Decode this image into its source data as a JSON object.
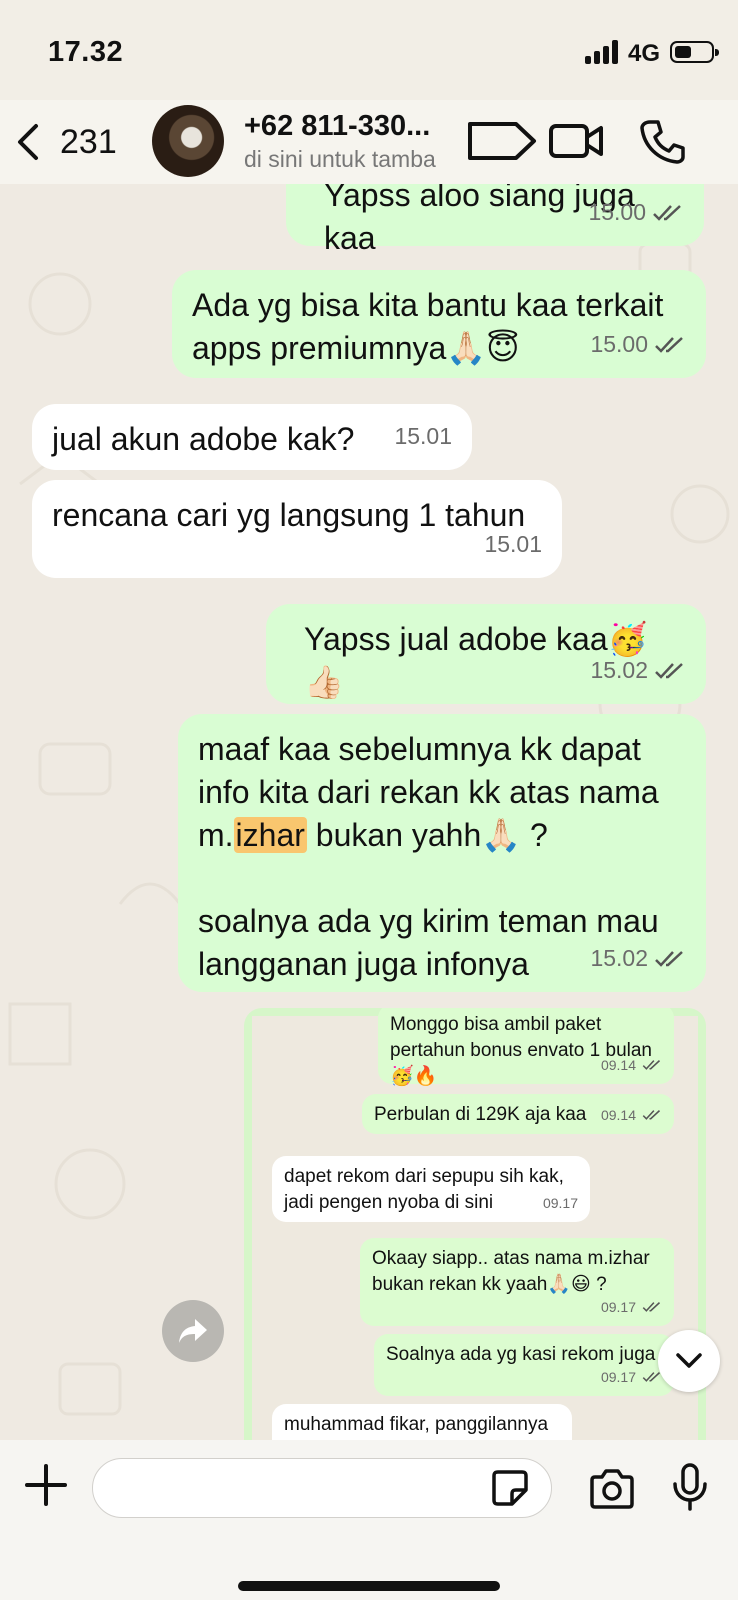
{
  "status": {
    "time": "17.32",
    "network": "4G",
    "battery_level": 0.35
  },
  "header": {
    "back_count": "231",
    "contact_name": "+62 811-330...",
    "contact_sub": "di sini untuk tamba"
  },
  "messages": [
    {
      "text": "Yapss aloo siang juga kaa",
      "time": "15.00"
    },
    {
      "text": "Ada yg bisa kita bantu kaa terkait apps premiumnya🙏🏻😇",
      "time": "15.00"
    },
    {
      "text": "jual akun adobe kak?",
      "time": "15.01"
    },
    {
      "text": "rencana cari yg langsung 1 tahun",
      "time": "15.01"
    },
    {
      "text": "Yapss jual adobe kaa🥳👍🏻",
      "time": "15.02"
    },
    {
      "line1": "maaf kaa sebelumnya kk dapat",
      "line2": "info kita dari rekan kk atas nama",
      "line3_pre": "m.",
      "line3_hl": "izhar",
      "line3_post": " bukan yahh🙏🏻 ?",
      "line4": "soalnya ada yg kirim teman mau",
      "line5": "langganan juga infonya",
      "time": "15.02"
    }
  ],
  "forwarded": [
    {
      "text": "Monggo bisa ambil paket pertahun bonus envato 1 bulan 🥳🔥",
      "time": "09.14"
    },
    {
      "text": "Perbulan di 129K aja kaa",
      "time": "09.14"
    },
    {
      "text": "dapet rekom dari sepupu sih kak, jadi pengen nyoba di sini",
      "time": "09.17"
    },
    {
      "text": "Okaay siapp.. atas nama m.izhar bukan rekan kk yaah🙏🏻😃 ?",
      "time": "09.17"
    },
    {
      "text": "Soalnya ada yg kasi rekom juga",
      "time": "09.17"
    },
    {
      "text": "muhammad fikar, panggilannya"
    }
  ]
}
